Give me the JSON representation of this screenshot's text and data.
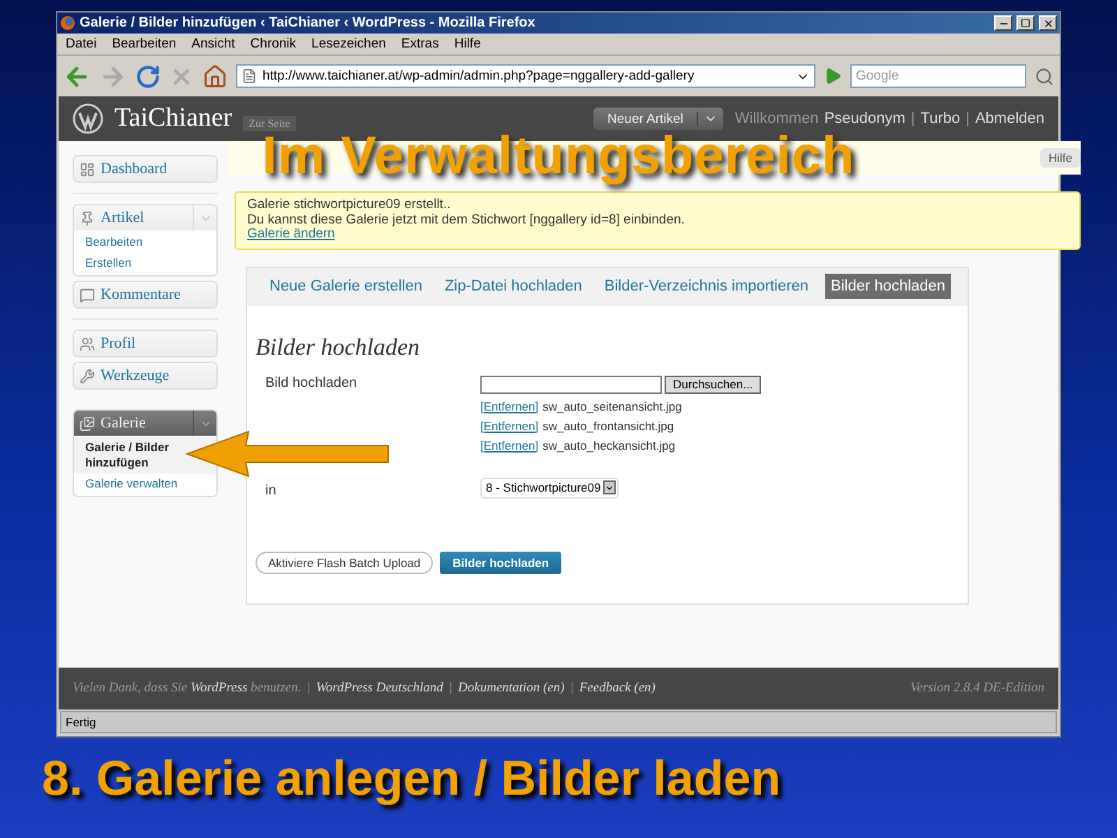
{
  "window": {
    "title": "Galerie / Bilder hinzufügen ‹ TaiChianer ‹ WordPress - Mozilla Firefox"
  },
  "menu": [
    "Datei",
    "Bearbeiten",
    "Ansicht",
    "Chronik",
    "Lesezeichen",
    "Extras",
    "Hilfe"
  ],
  "toolbar": {
    "url": "http://www.taichianer.at/wp-admin/admin.php?page=nggallery-add-gallery",
    "search_placeholder": "Google"
  },
  "header": {
    "site_title": "TaiChianer",
    "visit_site": "Zur Seite",
    "new_post": "Neuer Artikel",
    "greeting": "Willkommen",
    "user": "Pseudonym",
    "separator": "|",
    "links": [
      "Turbo",
      "Abmelden"
    ]
  },
  "help": "Hilfe",
  "sidebar": [
    {
      "kind": "group",
      "label": "Dashboard",
      "selected": false
    },
    {
      "kind": "separator"
    },
    {
      "kind": "group",
      "label": "Artikel",
      "selected": false,
      "expanded": true,
      "children": [
        {
          "label": "Bearbeiten",
          "selected": false
        },
        {
          "label": "Erstellen",
          "selected": false
        }
      ]
    },
    {
      "kind": "group",
      "label": "Kommentare",
      "selected": false
    },
    {
      "kind": "separator"
    },
    {
      "kind": "group",
      "label": "Profil",
      "selected": false
    },
    {
      "kind": "group",
      "label": "Werkzeuge",
      "selected": false
    },
    {
      "kind": "gap"
    },
    {
      "kind": "group",
      "label": "Galerie",
      "selected": true,
      "expanded": true,
      "children": [
        {
          "label": "Galerie / Bilder hinzufügen",
          "selected": true
        },
        {
          "label": "Galerie verwalten",
          "selected": false
        }
      ]
    }
  ],
  "notice": {
    "lines": [
      "Galerie stichwortpicture09 erstellt..",
      "Du kannst diese Galerie jetzt mit dem Stichwort [nggallery id=8] einbinden."
    ],
    "link": "Galerie ändern"
  },
  "tabs": [
    {
      "label": "Neue Galerie erstellen",
      "selected": false
    },
    {
      "label": "Zip-Datei hochladen",
      "selected": false
    },
    {
      "label": "Bilder-Verzeichnis importieren",
      "selected": false
    },
    {
      "label": "Bilder hochladen",
      "selected": true
    }
  ],
  "form": {
    "heading": "Bilder hochladen",
    "file_label": "Bild hochladen",
    "browse": "Durchsuchen...",
    "files": [
      {
        "remove": "[Entfernen]",
        "name": "sw_auto_seitenansicht.jpg"
      },
      {
        "remove": "[Entfernen]",
        "name": "sw_auto_frontansicht.jpg"
      },
      {
        "remove": "[Entfernen]",
        "name": "sw_auto_heckansicht.jpg"
      }
    ],
    "gallery_label": "in",
    "gallery_value": "8 - Stichwortpicture09",
    "flash_button": "Aktiviere Flash Batch Upload",
    "submit": "Bilder hochladen"
  },
  "footer": {
    "thanks_before": "Vielen Dank, dass Sie",
    "thanks_link": "WordPress",
    "thanks_after": "benutzen.",
    "separator": "|",
    "links": [
      "WordPress Deutschland",
      "Dokumentation (en)",
      "Feedback (en)"
    ],
    "version": "Version 2.8.4 DE-Edition"
  },
  "status": "Fertig",
  "overlay_title": "Im Verwaltungsbereich",
  "caption": "8. Galerie anlegen / Bilder laden"
}
